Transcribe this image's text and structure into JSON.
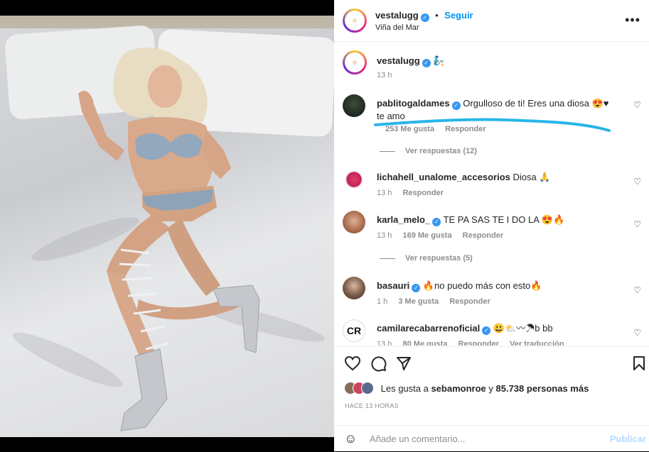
{
  "header": {
    "username": "vestalugg",
    "follow_label": "Seguir",
    "location": "Viña del Mar",
    "more_glyph": "•••"
  },
  "caption": {
    "username": "vestalugg",
    "emoji": "🧞",
    "time": "13 h"
  },
  "comments": [
    {
      "username": "pablitogaldames",
      "verified": true,
      "text": "Orgulloso de ti! Eres una diosa 😍♥ te amo",
      "time": "",
      "likes": "253 Me gusta",
      "reply_label": "Responder",
      "view_replies": "Ver respuestas (12)"
    },
    {
      "username": "lichahell_unalome_accesorios",
      "verified": false,
      "text": "Diosa 🙏",
      "time": "13 h",
      "reply_label": "Responder"
    },
    {
      "username": "karla_melo_",
      "verified": true,
      "text": "TE PA SAS TE I DO LA 😍🔥",
      "time": "13 h",
      "likes": "169 Me gusta",
      "reply_label": "Responder",
      "view_replies": "Ver respuestas (5)"
    },
    {
      "username": "basauri",
      "verified": true,
      "text": "🔥no puedo más con esto🔥",
      "time": "1 h",
      "likes": "3 Me gusta",
      "reply_label": "Responder"
    },
    {
      "username": "camilarecabarrenoficial",
      "verified": true,
      "text": "😃⛅〰☂b bb",
      "time": "13 h",
      "likes": "80 Me gusta",
      "reply_label": "Responder",
      "translate_label": "Ver traducción"
    }
  ],
  "likes_summary": {
    "prefix": "Les gusta a ",
    "user": "sebamonroe",
    "middle": " y ",
    "count": "85.738 personas más"
  },
  "timestamp": "HACE 13 HORAS",
  "add_comment": {
    "placeholder": "Añade un comentario...",
    "post_label": "Publicar"
  },
  "icons": {
    "like": "heart-icon",
    "comment": "comment-icon",
    "share": "paper-plane-icon",
    "save": "bookmark-icon",
    "emoji": "smiley-icon"
  },
  "colors": {
    "accent": "#0095f6",
    "verified": "#3897f0",
    "annotation_line": "#29b6e8"
  }
}
